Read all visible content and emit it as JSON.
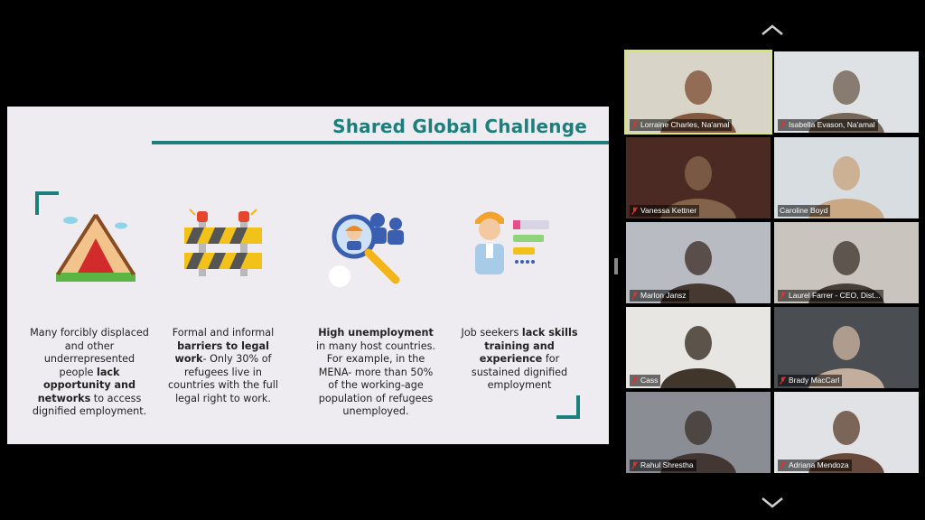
{
  "slide": {
    "title": "Shared Global Challenge",
    "columns": [
      {
        "text1": "Many forcibly displaced and other underrepresented people ",
        "bold1": "lack opportunity and networks",
        "text2": " to access dignified employment."
      },
      {
        "text1": "Formal and informal ",
        "bold1": "barriers to legal work",
        "text2": "- Only 30% of refugees live in countries with the full legal right to work."
      },
      {
        "text1": "",
        "bold1": "High unemployment",
        "text2": " in many host countries. For example, in the MENA- more than 50% of the working-age population of refugees unemployed."
      },
      {
        "text1": "Job seekers ",
        "bold1": "lack skills training and experience",
        "text2": " for sustained dignified employment"
      }
    ]
  },
  "participants": [
    {
      "name": "Lorraine Charles, Na'amal",
      "muted": true,
      "active": true
    },
    {
      "name": "Isabella Evason, Na'amal",
      "muted": true,
      "active": false
    },
    {
      "name": "Vanessa Kettner",
      "muted": true,
      "active": false
    },
    {
      "name": "Caroline Boyd",
      "muted": false,
      "active": false
    },
    {
      "name": "Marlon Jansz",
      "muted": true,
      "active": false
    },
    {
      "name": "Laurel Farrer - CEO, Dist...",
      "muted": true,
      "active": false
    },
    {
      "name": "Cass",
      "muted": true,
      "active": false
    },
    {
      "name": "Brady MacCarl",
      "muted": true,
      "active": false
    },
    {
      "name": "Rahul Shrestha",
      "muted": true,
      "active": false
    },
    {
      "name": "Adriana Mendoza",
      "muted": true,
      "active": false
    }
  ],
  "colors": {
    "accent": "#1d7f7c",
    "active_speaker": "#d8e676",
    "muted_icon": "#e0312b"
  },
  "icons": {
    "scroll_up": "chevron-up-icon",
    "scroll_down": "chevron-down-icon",
    "mute": "mic-muted-icon"
  }
}
